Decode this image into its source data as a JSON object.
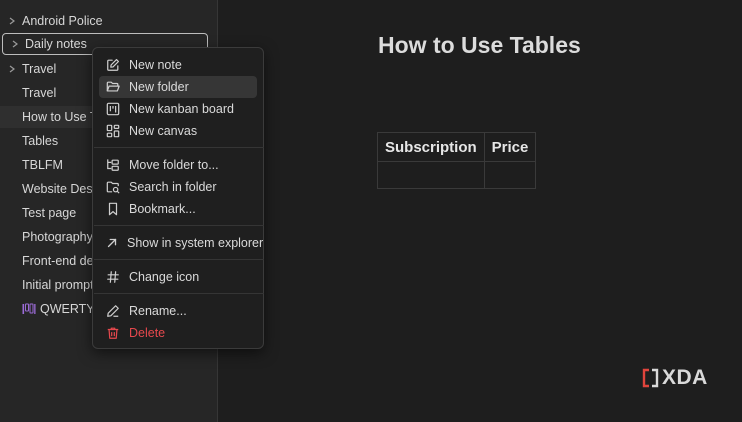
{
  "sidebar": {
    "items": [
      {
        "label": "Android Police",
        "type": "folder"
      },
      {
        "label": "Daily notes",
        "type": "folder"
      },
      {
        "label": "Travel",
        "type": "folder"
      },
      {
        "label": "Travel",
        "type": "file"
      },
      {
        "label": "How to Use Tables",
        "type": "file"
      },
      {
        "label": "Tables",
        "type": "file"
      },
      {
        "label": "TBLFM",
        "type": "file"
      },
      {
        "label": "Website Design",
        "type": "file"
      },
      {
        "label": "Test page",
        "type": "file"
      },
      {
        "label": "Photography",
        "type": "file"
      },
      {
        "label": "Front-end development",
        "type": "file"
      },
      {
        "label": "Initial prompts",
        "type": "file"
      },
      {
        "label": "QWERTYBOARD",
        "type": "kanban"
      }
    ]
  },
  "context_menu": {
    "items": [
      {
        "label": "New note",
        "icon": "edit-icon"
      },
      {
        "label": "New folder",
        "icon": "folder-open-icon"
      },
      {
        "label": "New kanban board",
        "icon": "kanban-icon"
      },
      {
        "label": "New canvas",
        "icon": "layout-dashboard-icon"
      },
      {
        "label": "Move folder to...",
        "icon": "folder-tree-icon"
      },
      {
        "label": "Search in folder",
        "icon": "search-folder-icon"
      },
      {
        "label": "Bookmark...",
        "icon": "bookmark-icon"
      },
      {
        "label": "Show in system explorer",
        "icon": "arrow-up-right-icon"
      },
      {
        "label": "Change icon",
        "icon": "hash-icon"
      },
      {
        "label": "Rename...",
        "icon": "pencil-icon"
      },
      {
        "label": "Delete",
        "icon": "trash-icon"
      }
    ]
  },
  "main": {
    "title": "How to Use Tables",
    "table": {
      "headers": [
        "Subscription",
        "Price"
      ]
    }
  },
  "watermark": {
    "text": "XDA"
  },
  "colors": {
    "background": "#1e1e1e",
    "sidebar": "#262626",
    "menu": "#1f1f1f",
    "danger": "#e5484d",
    "kanban_accent": "#9b6bd6",
    "watermark_accent": "#e0443c"
  }
}
